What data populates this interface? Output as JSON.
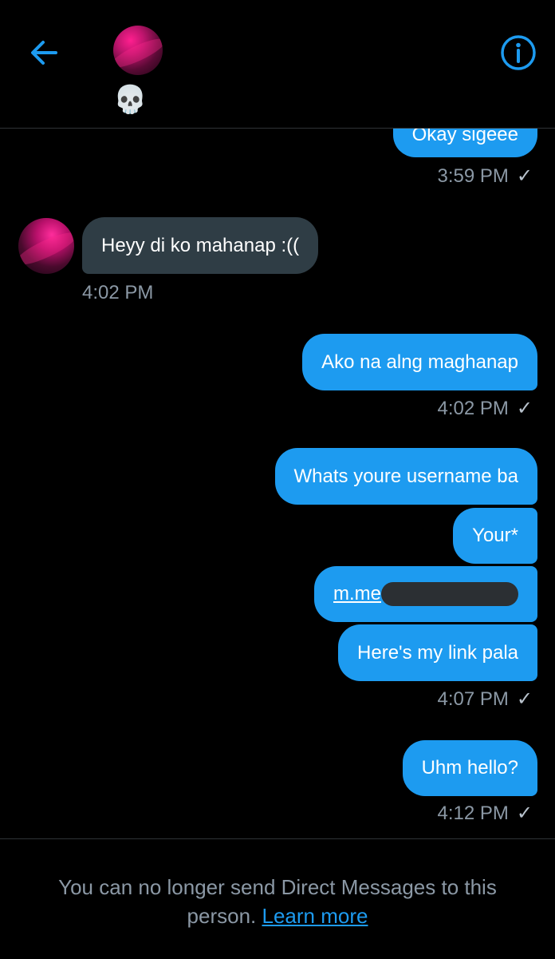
{
  "header": {
    "back_icon": "arrow-left-icon",
    "info_icon": "info-circle-icon",
    "display_name": "💀",
    "accent": "#1d9bf0"
  },
  "conversation": {
    "msg0": {
      "text": "Okay sigeee",
      "time": "3:59 PM",
      "status_icon": "checkmark-icon"
    },
    "msg1": {
      "text": "Heyy di ko mahanap :((",
      "time": "4:02 PM"
    },
    "msg2": {
      "text": "Ako na alng maghanap",
      "time": "4:02 PM",
      "status_icon": "checkmark-icon"
    },
    "group3": {
      "bubbles": [
        "Whats youre username ba",
        "Your*",
        "m.me",
        "Here's  my link pala"
      ],
      "time": "4:07 PM",
      "status_icon": "checkmark-icon"
    },
    "msg4": {
      "text": "Uhm hello?",
      "time": "4:12 PM",
      "status_icon": "checkmark-icon"
    }
  },
  "footer": {
    "notice": "You can no longer send Direct Messages to this person.",
    "learn_more": "Learn more"
  },
  "colors": {
    "background": "#000000",
    "outgoing_bubble": "#1d9bf0",
    "incoming_bubble": "#2f3d45",
    "meta_text": "#8b98a5"
  }
}
